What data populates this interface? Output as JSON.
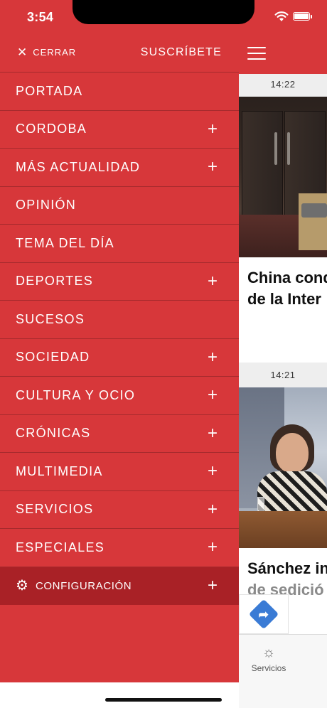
{
  "status_bar": {
    "time": "3:54",
    "battery_level": 1.0
  },
  "drawer": {
    "close_label": "CERRAR",
    "subscribe_label": "SUSCRÍBETE",
    "items": [
      {
        "label": "PORTADA",
        "expandable": false
      },
      {
        "label": "CORDOBA",
        "expandable": true
      },
      {
        "label": "MÁS ACTUALIDAD",
        "expandable": true
      },
      {
        "label": "OPINIÓN",
        "expandable": false
      },
      {
        "label": "TEMA DEL DÍA",
        "expandable": false
      },
      {
        "label": "DEPORTES",
        "expandable": true
      },
      {
        "label": "SUCESOS",
        "expandable": false
      },
      {
        "label": "SOCIEDAD",
        "expandable": true
      },
      {
        "label": "CULTURA Y OCIO",
        "expandable": true
      },
      {
        "label": "CRÓNICAS",
        "expandable": true
      },
      {
        "label": "MULTIMEDIA",
        "expandable": true
      },
      {
        "label": "SERVICIOS",
        "expandable": true
      },
      {
        "label": "ESPECIALES",
        "expandable": true
      }
    ],
    "config_label": "CONFIGURACIÓN",
    "icons": {
      "close": "close-icon",
      "expand": "plus-icon",
      "settings": "gear-icon"
    }
  },
  "background_feed": {
    "articles": [
      {
        "time": "14:22",
        "title_line1": "China cond",
        "title_line2": "de la Inter"
      },
      {
        "time": "14:21",
        "title_line1": "Sánchez in",
        "title_line2": "de sedició"
      }
    ],
    "tab_bar": {
      "items": [
        {
          "label": "Servicios",
          "icon": "sun-icon"
        }
      ]
    }
  },
  "colors": {
    "brand_red": "#d7373a",
    "config_row": "#a92126",
    "divider": "#a62a2d",
    "fab_blue": "#3a7bd5"
  }
}
